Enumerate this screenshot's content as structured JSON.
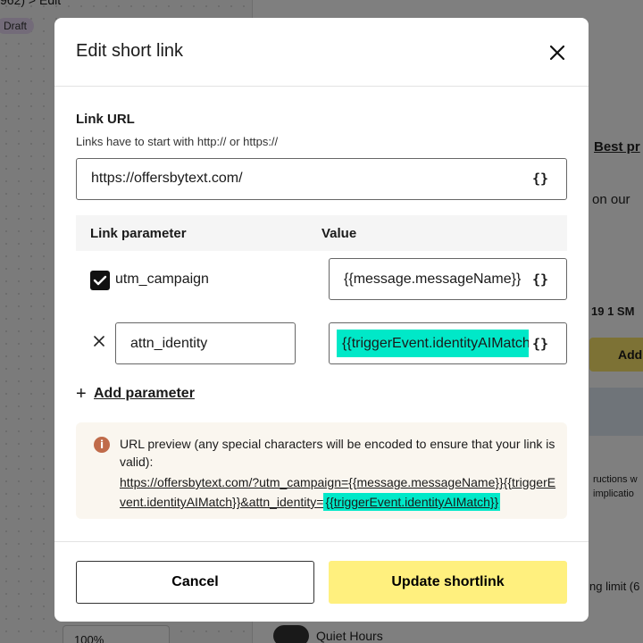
{
  "background": {
    "breadcrumb_suffix": "Edit",
    "draft_badge": "Draft",
    "right_text_1": "Best pr",
    "right_text_2": "on our",
    "right_text_3": "19  1 SM",
    "right_button": "Add",
    "right_text_4": "ructions w",
    "right_text_5": "implicatio",
    "right_text_6": "ng limit (6",
    "zoom": "100%",
    "quiet_hours": "Quiet Hours"
  },
  "modal": {
    "title": "Edit short link",
    "link_url_label": "Link URL",
    "link_url_hint": "Links have to start with http:// or https://",
    "link_url_value": "https://offersbytext.com/",
    "brace_label": "{}",
    "params_header": {
      "parameter": "Link parameter",
      "value": "Value"
    },
    "params": [
      {
        "key": "utm_campaign",
        "value": "{{message.messageName}}",
        "locked": true
      },
      {
        "key": "attn_identity",
        "value": "{{triggerEvent.identityAIMatch}}",
        "locked": false
      }
    ],
    "add_parameter": "Add parameter",
    "preview": {
      "title": "URL preview (any special characters will be encoded to ensure that your link is valid):",
      "link_main": "https://offersbytext.com/?utm_campaign={{message.messageName}}{{triggerEvent.identityAIMatch}}&attn_identity=",
      "link_highlight": "{{triggerEvent.identityAIMatch}}"
    },
    "cancel_label": "Cancel",
    "update_label": "Update shortlink"
  },
  "colors": {
    "highlight": "#00e8c8",
    "primary_button": "#fff07e",
    "info": "#c06b4a"
  }
}
